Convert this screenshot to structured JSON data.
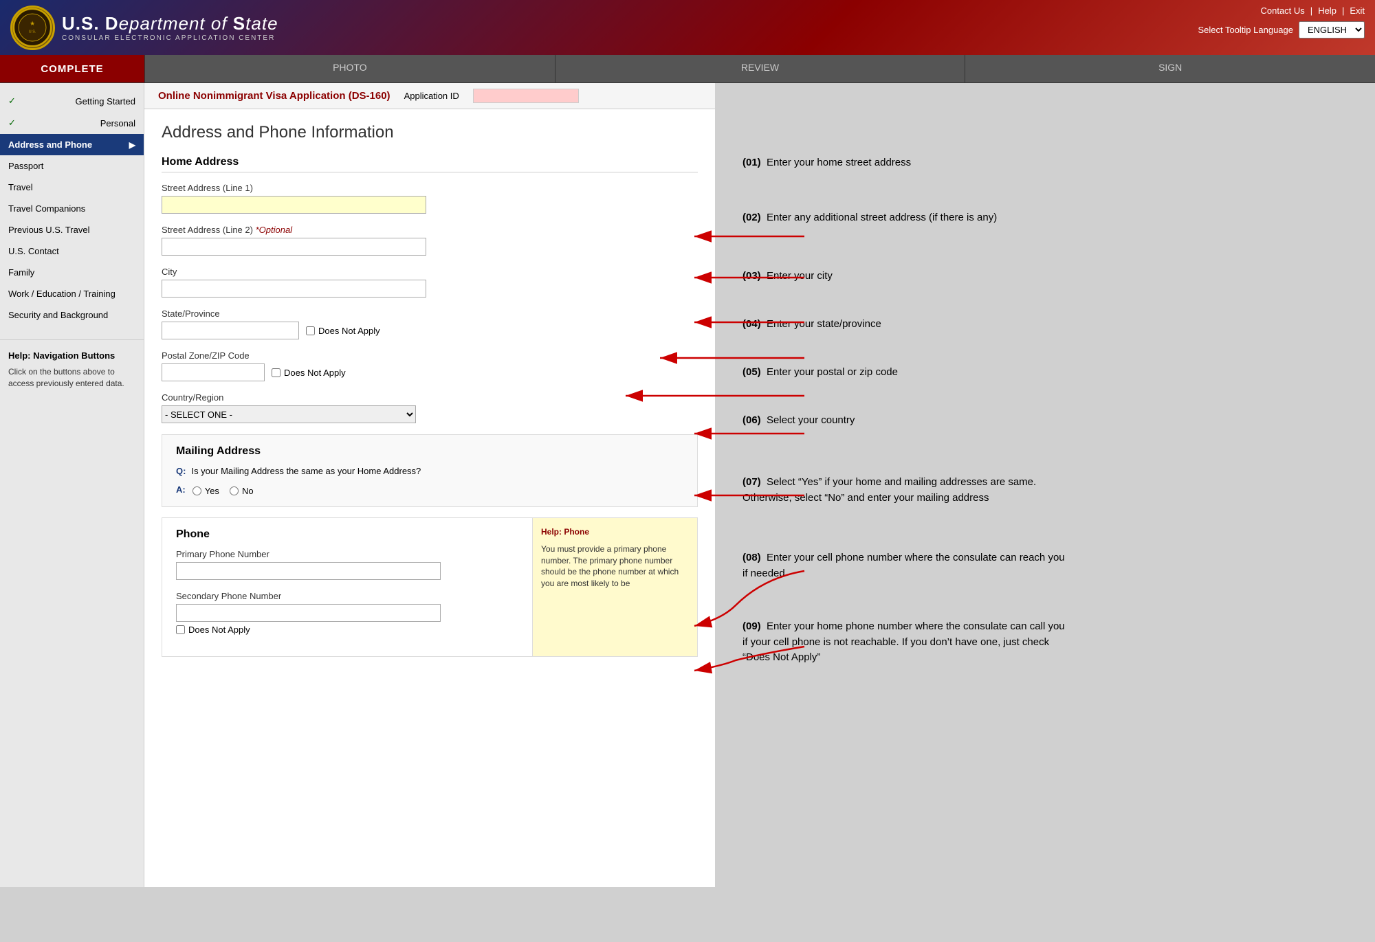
{
  "header": {
    "agency": "U.S. Department",
    "of": "of",
    "state": "State",
    "subtitle": "CONSULAR ELECTRONIC APPLICATION CENTER",
    "nav": {
      "contact": "Contact Us",
      "help": "Help",
      "exit": "Exit"
    },
    "tooltip_label": "Select Tooltip Language",
    "language": "ENGLISH"
  },
  "tabs": {
    "complete": "COMPLETE",
    "photo": "PHOTO",
    "review": "REVIEW",
    "sign": "SIGN"
  },
  "sidebar": {
    "items": [
      {
        "label": "Getting Started",
        "checked": true
      },
      {
        "label": "Personal",
        "checked": true
      },
      {
        "label": "Address and Phone",
        "checked": false,
        "active": true
      },
      {
        "label": "Passport",
        "checked": false
      },
      {
        "label": "Travel",
        "checked": false
      },
      {
        "label": "Travel Companions",
        "checked": false
      },
      {
        "label": "Previous U.S. Travel",
        "checked": false
      },
      {
        "label": "U.S. Contact",
        "checked": false
      },
      {
        "label": "Family",
        "checked": false
      },
      {
        "label": "Work / Education / Training",
        "checked": false
      },
      {
        "label": "Security and Background",
        "checked": false
      }
    ],
    "help_title": "Help: Navigation Buttons",
    "help_text": "Click on the buttons above to access previously entered data."
  },
  "app_bar": {
    "title": "Online Nonimmigrant Visa Application (DS-160)",
    "id_label": "Application ID",
    "id_value": ""
  },
  "page": {
    "heading": "Address and Phone Information"
  },
  "form": {
    "home_address": {
      "heading": "Home Address",
      "street1_label": "Street Address (Line 1)",
      "street1_placeholder": "",
      "street2_label": "Street Address (Line 2)",
      "street2_optional": "*Optional",
      "city_label": "City",
      "state_label": "State/Province",
      "state_dna": "Does Not Apply",
      "zip_label": "Postal Zone/ZIP Code",
      "zip_dna": "Does Not Apply",
      "country_label": "Country/Region",
      "country_default": "- SELECT ONE -"
    },
    "mailing_address": {
      "heading": "Mailing Address",
      "question": "Is your Mailing Address the same as your Home Address?",
      "q_prefix": "Q:",
      "a_prefix": "A:",
      "yes": "Yes",
      "no": "No"
    },
    "phone": {
      "heading": "Phone",
      "primary_label": "Primary Phone Number",
      "secondary_label": "Secondary Phone Number",
      "secondary_dna": "Does Not Apply",
      "help_title": "Help: Phone",
      "help_text": "You must provide a primary phone number. The primary phone number should be the phone number at which you are most likely to be"
    }
  },
  "annotations": [
    {
      "num": "(01)",
      "text": "Enter your home street address"
    },
    {
      "num": "(02)",
      "text": "Enter any additional street address (if there is any)"
    },
    {
      "num": "(03)",
      "text": "Enter your city"
    },
    {
      "num": "(04)",
      "text": "Enter your state/province"
    },
    {
      "num": "(05)",
      "text": "Enter your postal or zip code"
    },
    {
      "num": "(06)",
      "text": "Select your country"
    },
    {
      "num": "(07)",
      "text": "Select “Yes” if your home and mailing addresses are same. Otherwise, select “No” and enter your mailing address"
    },
    {
      "num": "(08)",
      "text": "Enter your cell phone number where the consulate can reach you if needed"
    },
    {
      "num": "(09)",
      "text": "Enter your home phone number where the consulate can call you if your cell phone is not reachable. If you don’t have one, just check “Does Not Apply”"
    }
  ]
}
